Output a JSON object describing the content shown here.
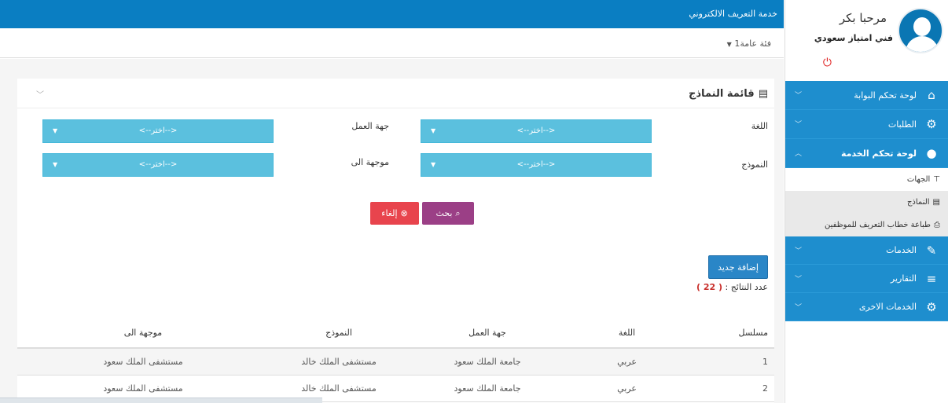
{
  "topbar": {
    "title": "خدمة التعريف الالكتروني"
  },
  "catbar": {
    "category": "فئة عامة1"
  },
  "user": {
    "greeting": "مرحبا بكر",
    "role": "فني امتياز سعودي"
  },
  "sidebar": {
    "items": [
      {
        "label": "لوحة تحكم البوابة",
        "icon": "home-icon"
      },
      {
        "label": "الطلبات",
        "icon": "gears-icon"
      },
      {
        "label": "لوحة تحكم الخدمة",
        "icon": "user-icon"
      }
    ],
    "submenu": [
      {
        "label": "الجهات",
        "icon": "sitemap-icon"
      },
      {
        "label": "النماذج",
        "icon": "file-icon"
      },
      {
        "label": "طباعة خطاب التعريف للموظفين",
        "icon": "print-icon"
      }
    ],
    "items2": [
      {
        "label": "الخدمات",
        "icon": "wrench-icon"
      },
      {
        "label": "التقارير",
        "icon": "list-icon"
      },
      {
        "label": "الخدمات الاخرى",
        "icon": "gears-icon"
      }
    ]
  },
  "panel": {
    "title": "قائمة النماذج"
  },
  "filters": {
    "language_label": "اللغة",
    "employer_label": "جهة العمل",
    "template_label": "النموذج",
    "addressed_to_label": "موجهة الى",
    "placeholder": "<--اختر-->"
  },
  "buttons": {
    "search": "بحث",
    "cancel": "إلغاء",
    "add_new": "إضافة جديد"
  },
  "results": {
    "count_label": "عدد النتائج :",
    "count_value": "( 22 )"
  },
  "table": {
    "headers": [
      "مسلسل",
      "اللغة",
      "جهة العمل",
      "النموذج",
      "موجهة الى"
    ],
    "rows": [
      [
        "1",
        "عربي",
        "جامعة الملك سعود",
        "مستشفى الملك خالد",
        "مستشفى الملك سعود"
      ],
      [
        "2",
        "عربي",
        "جامعة الملك سعود",
        "مستشفى الملك خالد",
        "مستشفى الملك سعود"
      ]
    ]
  },
  "colors": {
    "primary": "#0a7ec2",
    "menu": "#1e8ece",
    "select": "#5bc0de",
    "search": "#9b3f86",
    "cancel": "#e8444d",
    "count": "#c9302c"
  }
}
